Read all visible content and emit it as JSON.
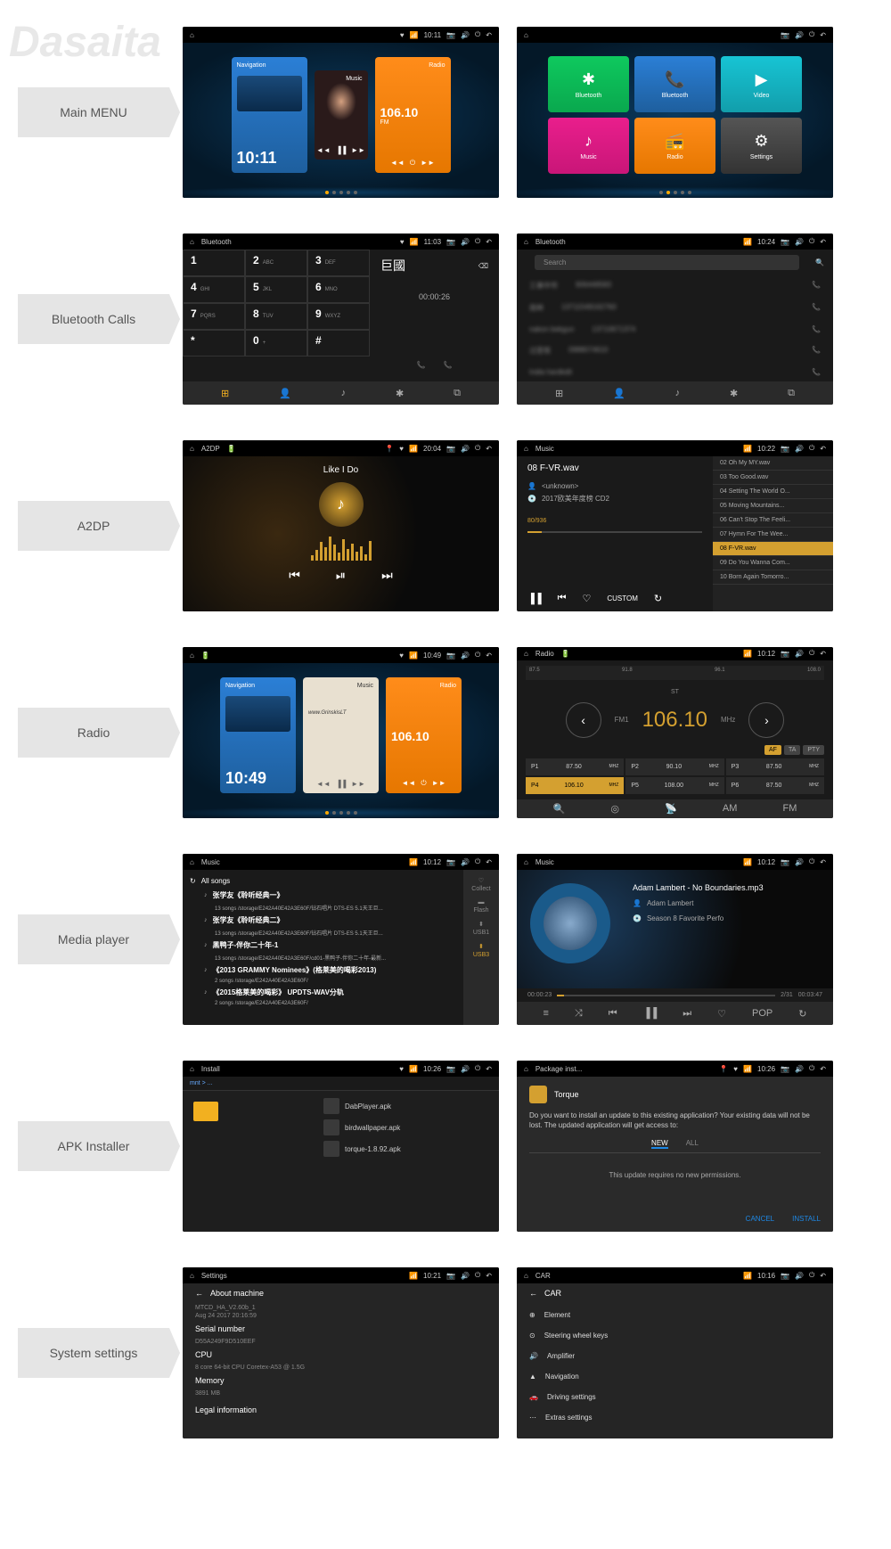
{
  "watermark": "Dasaita",
  "labels": {
    "main_menu": "Main MENU",
    "bluetooth": "Bluetooth Calls",
    "a2dp": "A2DP",
    "radio": "Radio",
    "media": "Media player",
    "apk": "APK Installer",
    "settings": "System settings"
  },
  "main1": {
    "time_sb": "10:11",
    "nav_label": "Navigation",
    "nav_time": "10:11",
    "music_label": "Music",
    "radio_label": "Radio",
    "radio_freq": "106.10"
  },
  "main2": {
    "tiles": [
      {
        "label": "Bluetooth",
        "cls": "tile-green"
      },
      {
        "label": "Bluetooth",
        "cls": "tile-blue"
      },
      {
        "label": "Video",
        "cls": "tile-cyan"
      },
      {
        "label": "Music",
        "cls": "tile-pink"
      },
      {
        "label": "Radio",
        "cls": "tile-orange"
      },
      {
        "label": "Settings",
        "cls": "tile-gray"
      }
    ]
  },
  "bt1": {
    "title": "Bluetooth",
    "time": "11:03",
    "keys": [
      [
        "1",
        ""
      ],
      [
        "2",
        "ABC"
      ],
      [
        "3",
        "DEF"
      ],
      [
        "4",
        "GHI"
      ],
      [
        "5",
        "JKL"
      ],
      [
        "6",
        "MNO"
      ],
      [
        "7",
        "PQRS"
      ],
      [
        "8",
        "TUV"
      ],
      [
        "9",
        "WXYZ"
      ],
      [
        "*",
        ""
      ],
      [
        "0",
        "+"
      ],
      [
        "#",
        ""
      ]
    ],
    "number": "巨國",
    "duration": "00:00:26"
  },
  "bt2": {
    "title": "Bluetooth",
    "time": "10:24",
    "search": "Search",
    "contacts": [
      {
        "name": "工事中市",
        "num": "906448583"
      },
      {
        "name": "南林",
        "num": "13711549162760"
      },
      {
        "name": "nakon bekgun",
        "num": "13710671374"
      },
      {
        "name": "过意恨",
        "num": "0988074610"
      },
      {
        "name": "India hardkdit",
        "num": ""
      }
    ]
  },
  "a2dp1": {
    "title": "A2DP",
    "time": "20:04",
    "song": "Like I Do"
  },
  "a2dp2": {
    "title": "Music",
    "time": "10:22",
    "song": "08 F-VR.wav",
    "artist": "<unknown>",
    "album": "2017欧美年度榜 CD2",
    "pos": "80/936",
    "tracks": [
      "02 Oh My MY.wav",
      "03 Too Good.wav",
      "04 Setting The World O...",
      "05 Moving Mountains...",
      "06 Can't Stop The Feeli...",
      "07 Hymn For The Wee...",
      "08 F-VR.wav",
      "09 Do You Wanna Com...",
      "10 Born Again Tomorro..."
    ],
    "custom": "CUSTOM"
  },
  "radio1": {
    "time": "10:49",
    "nav": "Navigation",
    "nav_time": "10:49",
    "music": "Music",
    "radio": "Radio",
    "freq": "106.10"
  },
  "radio2": {
    "title": "Radio",
    "time": "10:12",
    "band": "FM1",
    "freq": "106.10",
    "unit": "MHz",
    "st": "ST",
    "scale": [
      "87.5",
      "91.8",
      "96.1",
      "108.0"
    ],
    "btns": {
      "af": "AF",
      "ta": "TA",
      "pty": "PTY"
    },
    "presets": [
      {
        "p": "P1",
        "f": "87.50",
        "u": "MHZ"
      },
      {
        "p": "P2",
        "f": "90.10",
        "u": "MHZ"
      },
      {
        "p": "P3",
        "f": "87.50",
        "u": "MHZ"
      },
      {
        "p": "P4",
        "f": "106.10",
        "u": "MHZ"
      },
      {
        "p": "P5",
        "f": "108.00",
        "u": "MHZ"
      },
      {
        "p": "P6",
        "f": "87.50",
        "u": "MHZ"
      }
    ],
    "bottom": {
      "am": "AM",
      "fm": "FM"
    }
  },
  "media1": {
    "title": "Music",
    "time": "10:12",
    "all": "All songs",
    "items": [
      {
        "t": "张学友《聆听经典一》",
        "s": "13 songs /storage/E242A40E42A3E60F/钻石唱片 DTS-ES 5.1天王巨..."
      },
      {
        "t": "张学友《聆听经典二》",
        "s": "13 songs /storage/E242A40E42A3E60F/钻石唱片 DTS-ES 5.1天王巨..."
      },
      {
        "t": "黑鸭子-伴你二十年-1",
        "s": "13 songs /storage/E242A40E42A3E60F/cd01-黑鸭子-伴你二十年-最新..."
      },
      {
        "t": "《2013 GRAMMY Nominees》(格莱美的喝彩2013)",
        "s": "2 songs /storage/E242A40E42A3E60F/"
      },
      {
        "t": "《2015格莱美的喝彩》 UPDTS-WAV分轨",
        "s": "2 songs /storage/E242A40E42A3E60F/"
      }
    ],
    "side": [
      {
        "l": "Collect"
      },
      {
        "l": "Flash"
      },
      {
        "l": "USB1"
      },
      {
        "l": "USB3"
      }
    ]
  },
  "media2": {
    "title": "Music",
    "time": "10:12",
    "song": "Adam Lambert - No Boundaries.mp3",
    "artist": "Adam Lambert",
    "album": "Season 8 Favorite Perfo",
    "elapsed": "00:00:23",
    "pos": "2/31",
    "total": "00:03:47",
    "pop": "POP"
  },
  "apk1": {
    "title": "Install",
    "time": "10:26",
    "path": "mnt > ...",
    "files": [
      "DabPlayer.apk",
      "birdwallpaper.apk",
      "torque-1.8.92.apk"
    ]
  },
  "apk2": {
    "title": "Package inst...",
    "time": "10:26",
    "app": "Torque",
    "text": "Do you want to install an update to this existing application? Your existing data will not be lost. The updated application will get access to:",
    "tab_new": "NEW",
    "tab_all": "ALL",
    "msg": "This update requires no new permissions.",
    "cancel": "CANCEL",
    "install": "INSTALL"
  },
  "settings1": {
    "title": "Settings",
    "time": "10:21",
    "back": "About machine",
    "model": "MTCD_HA_V2.60b_1",
    "date": "Aug 24 2017 20:16:59",
    "serial_l": "Serial number",
    "serial": "D55A249F9D510EEF",
    "cpu_l": "CPU",
    "cpu": "8 core 64-bit CPU Coretex-A53 @ 1.5G",
    "mem_l": "Memory",
    "mem": "3891 MB",
    "legal": "Legal information"
  },
  "settings2": {
    "title": "CAR",
    "time": "10:16",
    "back": "CAR",
    "items": [
      "Element",
      "Steering wheel keys",
      "Amplifier",
      "Navigation",
      "Driving settings",
      "Extras settings"
    ]
  }
}
